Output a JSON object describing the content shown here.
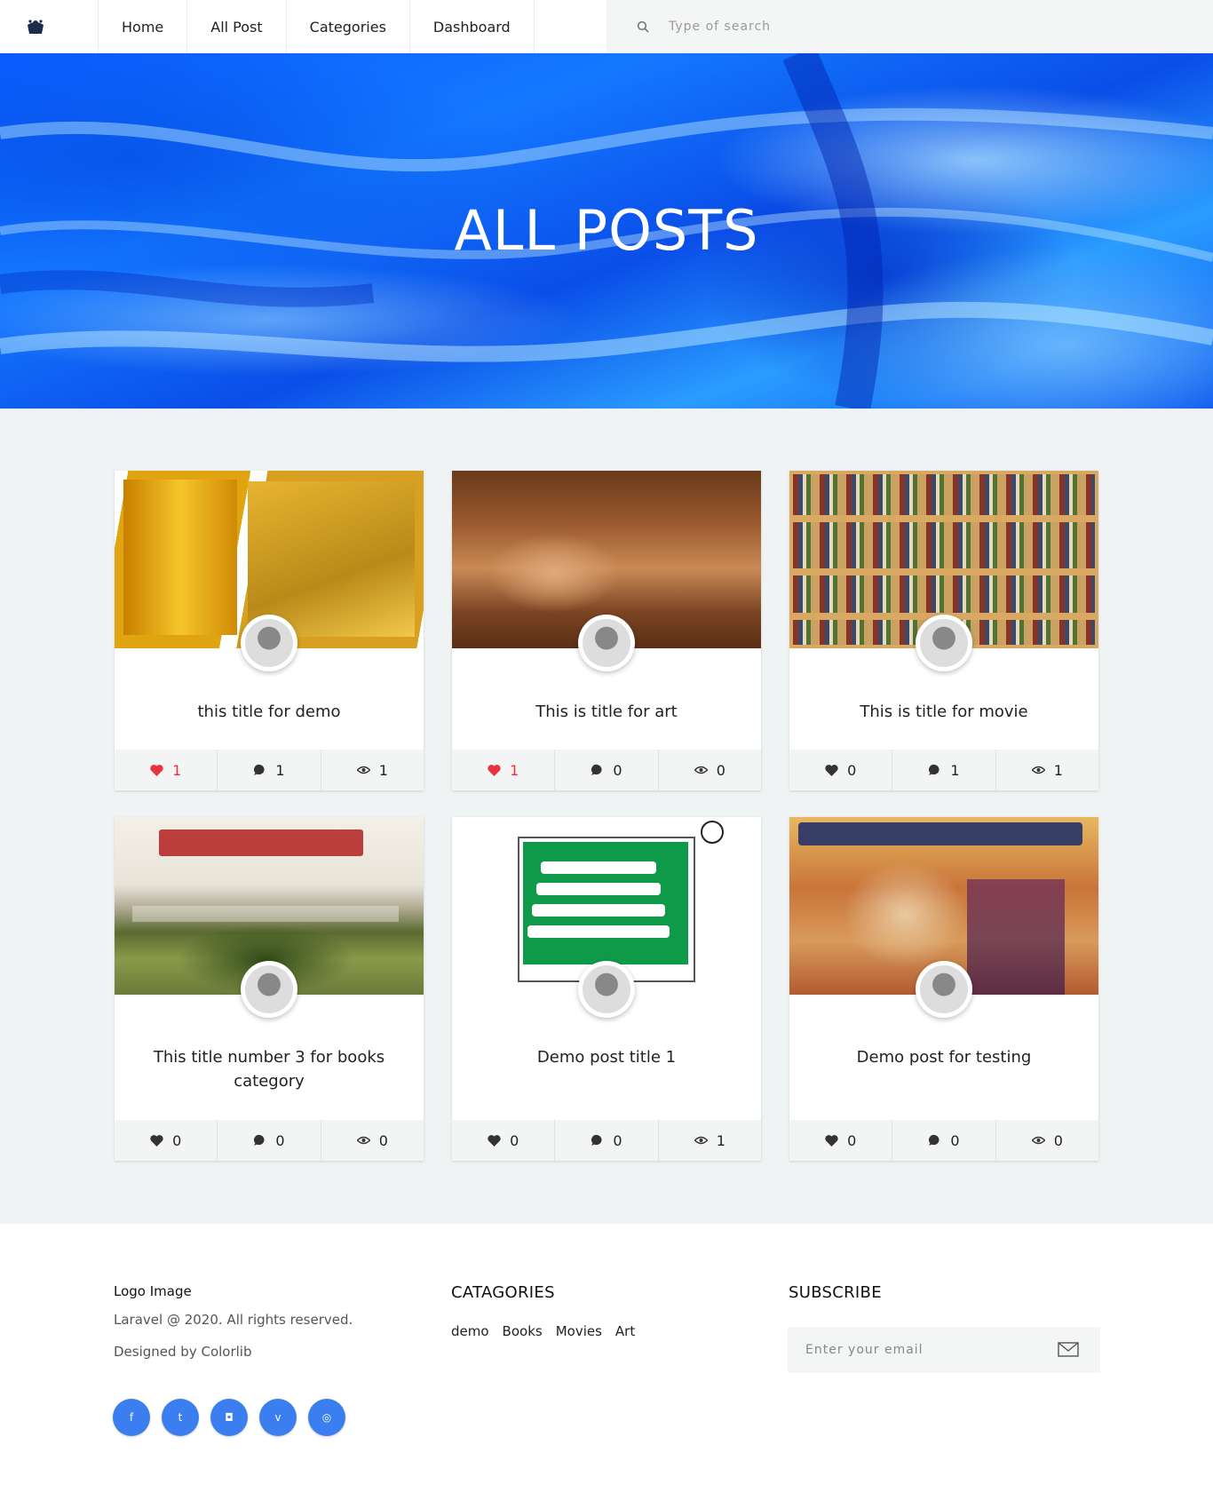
{
  "nav": {
    "links": [
      "Home",
      "All Post",
      "Categories",
      "Dashboard"
    ],
    "search_placeholder": "Type of search"
  },
  "hero": {
    "title": "ALL POSTS"
  },
  "posts": [
    {
      "title": "this title for demo",
      "likes": "1",
      "comments": "1",
      "views": "1",
      "liked": true
    },
    {
      "title": "This is title for art",
      "likes": "1",
      "comments": "0",
      "views": "0",
      "liked": true
    },
    {
      "title": "This is title for movie",
      "likes": "0",
      "comments": "1",
      "views": "1",
      "liked": false
    },
    {
      "title": "This title number 3 for books category",
      "likes": "0",
      "comments": "0",
      "views": "0",
      "liked": false
    },
    {
      "title": "Demo post title 1",
      "likes": "0",
      "comments": "0",
      "views": "1",
      "liked": false
    },
    {
      "title": "Demo post for testing",
      "likes": "0",
      "comments": "0",
      "views": "0",
      "liked": false
    }
  ],
  "footer": {
    "logo_text": "Logo Image",
    "copyright": "Laravel @ 2020. All rights reserved.",
    "designed_by": "Designed by Colorlib",
    "categories_title": "CATAGORIES",
    "categories": [
      "demo",
      "Books",
      "Movies",
      "Art"
    ],
    "subscribe_title": "SUBSCRIBE",
    "email_placeholder": "Enter your email",
    "social": [
      "facebook-icon",
      "twitter-icon",
      "instagram-icon",
      "vimeo-icon",
      "pinterest-icon"
    ]
  },
  "colors": {
    "accent_blue": "#3b7ef0",
    "liked_red": "#e8333e",
    "section_bg": "#f0f3f3"
  }
}
